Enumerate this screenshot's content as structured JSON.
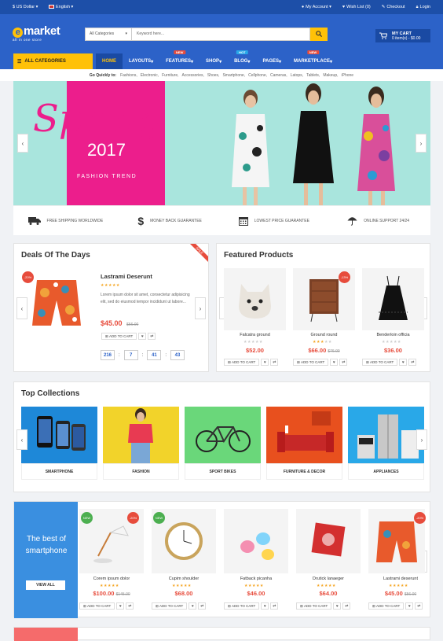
{
  "topbar": {
    "currency": "US Dollar",
    "language": "English",
    "my_account": "My Account",
    "wishlist": "Wish List (0)",
    "checkout": "Checkout",
    "login": "Login"
  },
  "header": {
    "logo_letter": "e",
    "logo_text": "market",
    "logo_tagline": "all in one store",
    "search_category": "All Categories",
    "search_placeholder": "Keyword here...",
    "cart_label": "MY CART",
    "cart_summary": "0 item(s) - $0.00"
  },
  "nav": {
    "all_categories": "ALL CATEGORIES",
    "items": [
      {
        "label": "HOME",
        "badge": ""
      },
      {
        "label": "LAYOUTS",
        "badge": ""
      },
      {
        "label": "FEATURES",
        "badge": "NEW"
      },
      {
        "label": "SHOP",
        "badge": ""
      },
      {
        "label": "BLOG",
        "badge": "HOT"
      },
      {
        "label": "PAGES",
        "badge": ""
      },
      {
        "label": "MARKETPLACE",
        "badge": "NEW"
      }
    ]
  },
  "quick": {
    "label": "Go Quickly to:",
    "links": [
      "Fashions,",
      "Electronic,",
      "Furniture,",
      "Accessories,",
      "Shoes,",
      "Smartphone,",
      "Cellphone,",
      "Cameras,",
      "Latops,",
      "Tablets,",
      "Makeup,",
      "iPhone"
    ]
  },
  "banner": {
    "headline": "Spring",
    "year": "2017",
    "subtitle": "FASHION TREND"
  },
  "features": [
    "FREE SHIPPING WORLDWIDE",
    "MONEY BACK GUARANTEE",
    "LOWEST PRICE GUARANTEE",
    "ONLINE SUPPORT 24/24"
  ],
  "deals": {
    "title": "Deals Of The Days",
    "ribbon": "SALE",
    "product": "Lastrami Deserunt",
    "discount": "-20%",
    "description": "Lorem ipsum dolor sit amet, consectetur adipisicing elit, sed do eiusmod tempor incididunt ut labore...",
    "price": "$45.00",
    "old_price": "$56.00",
    "add_to_cart": "ADD TO CART",
    "countdown": [
      "216",
      "7",
      "41",
      "43"
    ],
    "rating": 5
  },
  "featured": {
    "title": "Featured Products",
    "products": [
      {
        "name": "Falcatra ground",
        "price": "$52.00",
        "old_price": "",
        "badge": "",
        "rating": 0
      },
      {
        "name": "Ground round",
        "price": "$66.00",
        "old_price": "$76.00",
        "badge": "-13%",
        "rating": 3
      },
      {
        "name": "Benderloin officia",
        "price": "$36.00",
        "old_price": "",
        "badge": "",
        "rating": 0
      }
    ],
    "add_to_cart": "ADD TO CART"
  },
  "collections": {
    "title": "Top Collections",
    "items": [
      "SMARTPHONE",
      "FASHION",
      "SPORT BIKES",
      "FURNITURE & DECOR",
      "APPLIANCES"
    ]
  },
  "smartphone_block": {
    "promo": "The best of smartphone",
    "view_all": "VIEW ALL",
    "products": [
      {
        "name": "Corem ipsum dolor",
        "price": "$100.00",
        "old_price": "$145.00",
        "badge_new": "NEW",
        "badge_disc": "-20%"
      },
      {
        "name": "Cupim shoulder",
        "price": "$68.00",
        "old_price": "",
        "badge_new": "NEW",
        "badge_disc": ""
      },
      {
        "name": "Fatback picanha",
        "price": "$46.00",
        "old_price": "",
        "badge_new": "",
        "badge_disc": ""
      },
      {
        "name": "Drutick lanaeger",
        "price": "$64.00",
        "old_price": "",
        "badge_new": "",
        "badge_disc": ""
      },
      {
        "name": "Lastrami deserunt",
        "price": "$45.00",
        "old_price": "$56.00",
        "badge_new": "",
        "badge_disc": "-20%"
      }
    ],
    "add_to_cart": "ADD TO CART"
  },
  "colors": {
    "primary": "#2c62c8",
    "dark": "#1d4fa8",
    "accent": "#ffc107",
    "sale": "#e74c3c",
    "pink": "#ec1e8c"
  }
}
